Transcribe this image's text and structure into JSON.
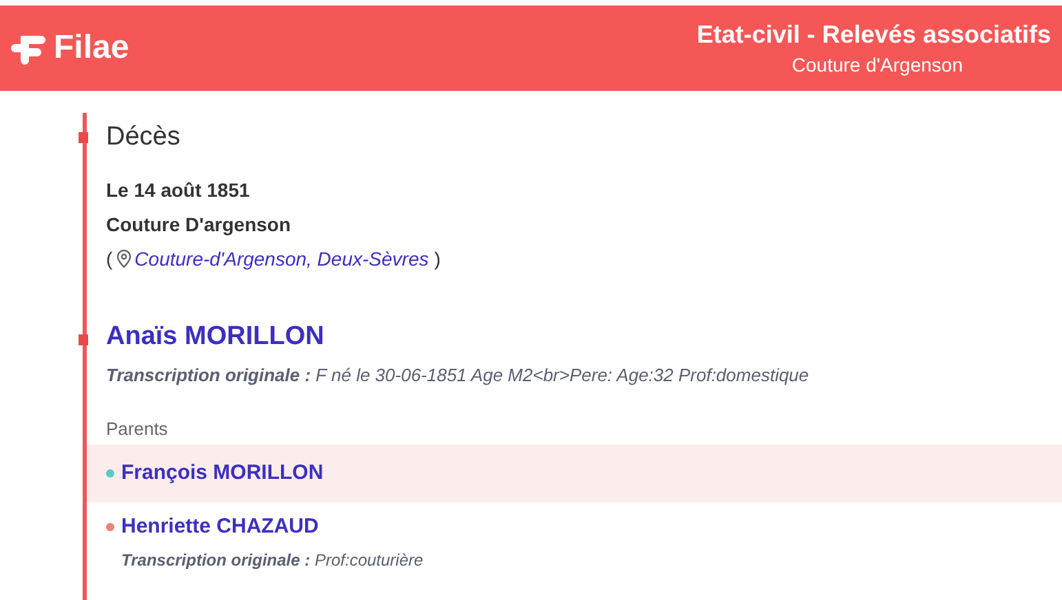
{
  "header": {
    "logo": "Filae",
    "title": "Etat-civil - Relevés associatifs",
    "subtitle": "Couture d'Argenson"
  },
  "event": {
    "title": "Décès",
    "date": "Le 14 août 1851",
    "place": "Couture D'argenson",
    "open_paren": "(",
    "location_link": "Couture-d'Argenson, Deux-Sèvres",
    "close_paren": ")"
  },
  "person": {
    "name": "Anaïs MORILLON",
    "transcription": "**Transcription originale :** F né le 30-06-1851 Age M2<br>Pere: Age:32 Prof:domestique"
  },
  "parents_label": "Parents",
  "parents": [
    {
      "name": "François MORILLON",
      "color": "#5bc8c8",
      "selected": true
    },
    {
      "name": "Henriette CHAZAUD",
      "color": "#f08080",
      "selected": false,
      "transcription": "**Transcription originale :** Prof:couturière"
    }
  ]
}
